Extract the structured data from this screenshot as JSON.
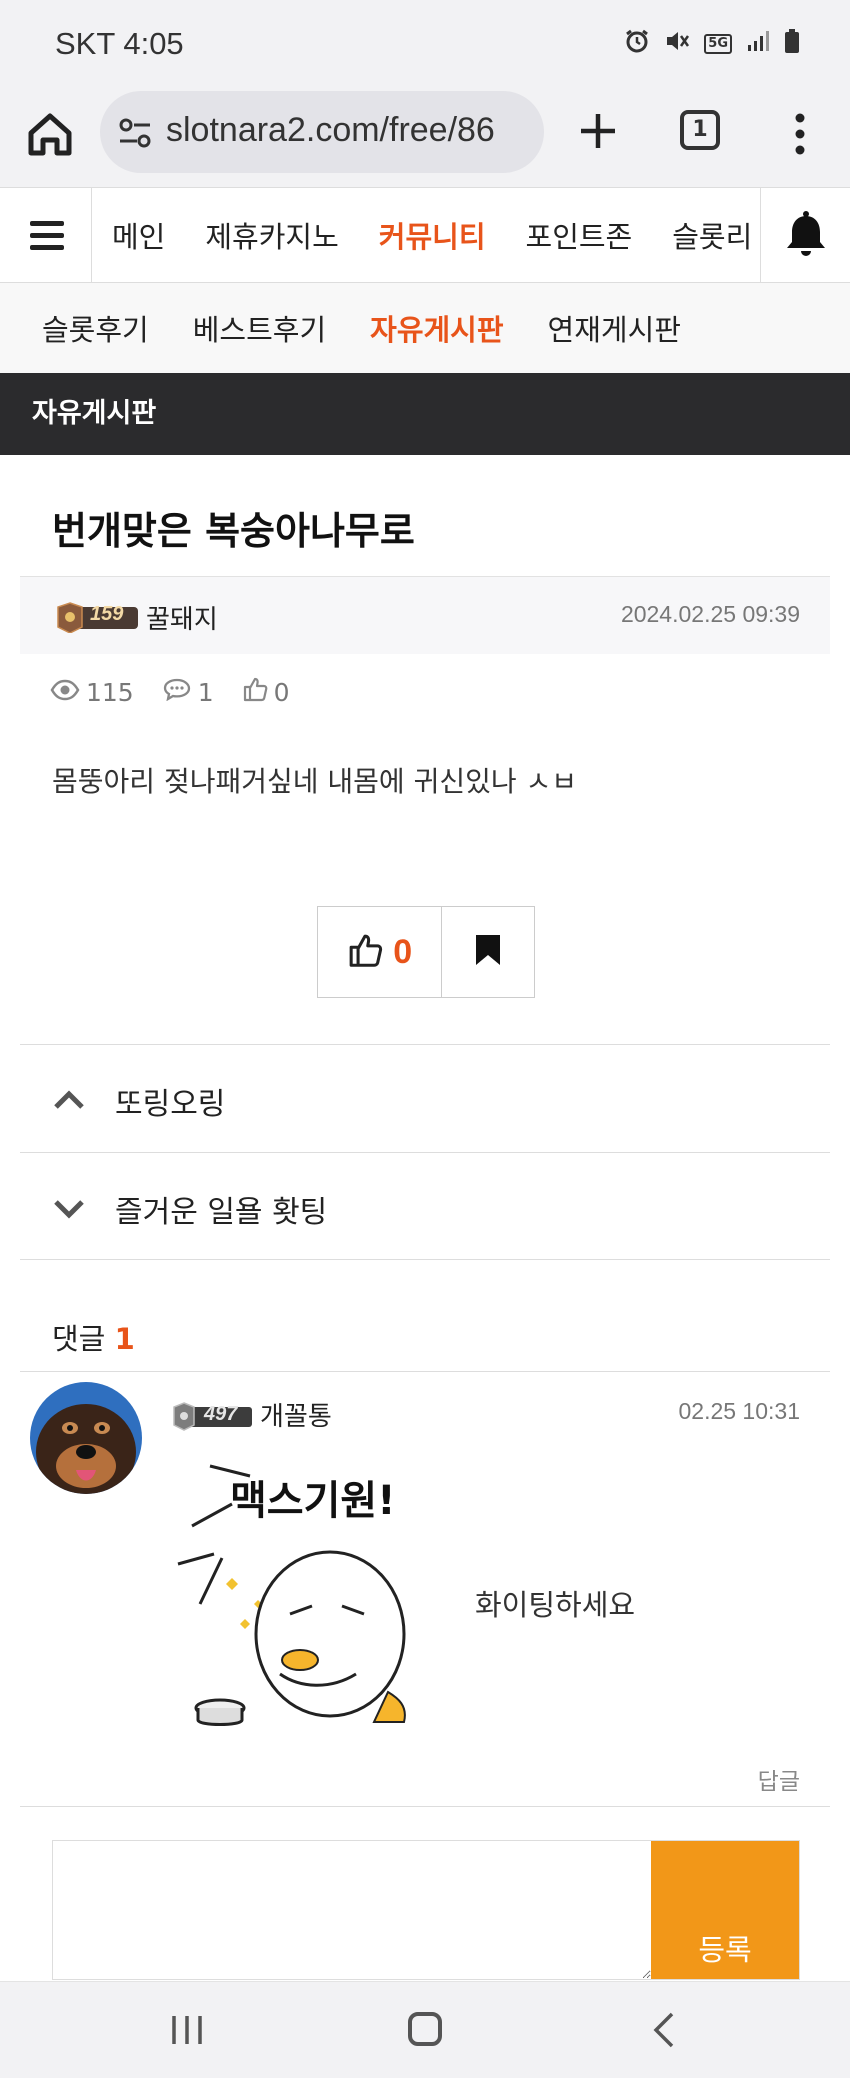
{
  "status_bar": {
    "time": "SKT 4:05",
    "icons": [
      "alarm-icon",
      "mute-icon",
      "5g-icon",
      "signal-icon",
      "battery-icon"
    ],
    "network": "5G"
  },
  "browser": {
    "url": "slotnara2.com/free/86",
    "tab_count": "1"
  },
  "site_nav": {
    "items": [
      {
        "label": "메인",
        "active": false
      },
      {
        "label": "제휴카지노",
        "active": false
      },
      {
        "label": "커뮤니티",
        "active": true
      },
      {
        "label": "포인트존",
        "active": false
      },
      {
        "label": "슬롯리",
        "active": false
      }
    ]
  },
  "sub_nav": {
    "items": [
      {
        "label": "슬롯후기",
        "active": false
      },
      {
        "label": "베스트후기",
        "active": false
      },
      {
        "label": "자유게시판",
        "active": true
      },
      {
        "label": "연재게시판",
        "active": false
      }
    ]
  },
  "board": {
    "title": "자유게시판"
  },
  "post": {
    "title": "번개맞은 복숭아나무로",
    "author_level": "159",
    "author": "꿀돼지",
    "date": "2024.02.25 09:39",
    "views": "115",
    "comments": "1",
    "likes": "0",
    "body": "몸뚱아리 젖나패거싶네 내몸에 귀신있나 ㅅㅂ",
    "like_button_count": "0"
  },
  "adjacent_posts": {
    "prev": "또링오링",
    "next": "즐거운 일욜 홧팅"
  },
  "comments_section": {
    "label": "댓글",
    "count": "1"
  },
  "comment": {
    "level": "497",
    "author": "개꼴통",
    "date": "02.25 10:31",
    "sticker_text": "맥스기원!",
    "text": "화이팅하세요",
    "reply_label": "답글"
  },
  "reply_form": {
    "submit_label": "등록",
    "placeholder": ""
  },
  "colors": {
    "accent": "#e8541a",
    "submit": "#f29718",
    "board_bar": "#2b2b2d"
  }
}
